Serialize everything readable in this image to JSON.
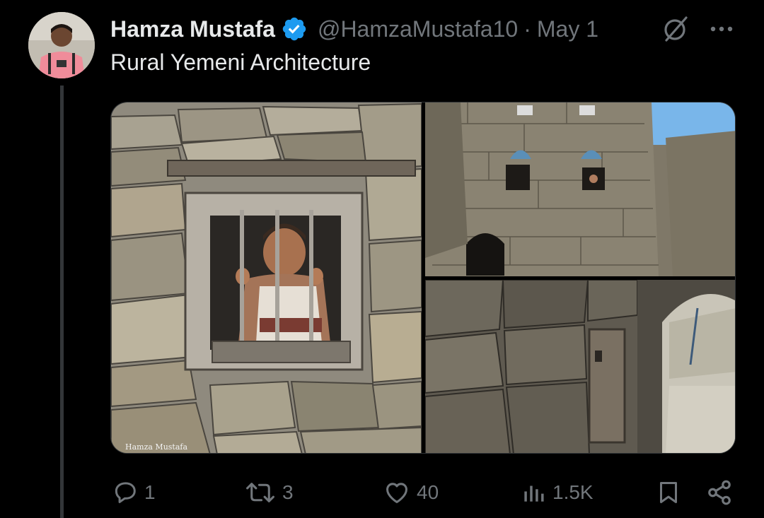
{
  "tweet": {
    "author_name": "Hamza Mustafa",
    "handle": "@HamzaMustafa10",
    "separator": "·",
    "date": "May 1",
    "text": "Rural Yemeni Architecture",
    "verified": true
  },
  "media": {
    "watermark": "Hamza Mustafa"
  },
  "actions": {
    "replies": "1",
    "reposts": "3",
    "likes": "40",
    "views": "1.5K"
  },
  "colors": {
    "background": "#000000",
    "text_primary": "#e7e9ea",
    "text_secondary": "#71767b",
    "verified_blue": "#1d9bf0",
    "thread_line": "#333639"
  },
  "icons": {
    "verified": "verified-badge-icon",
    "grok": "grok-icon",
    "more": "more-icon",
    "reply": "reply-icon",
    "repost": "repost-icon",
    "like": "heart-icon",
    "views": "views-icon",
    "bookmark": "bookmark-icon",
    "share": "share-icon"
  }
}
